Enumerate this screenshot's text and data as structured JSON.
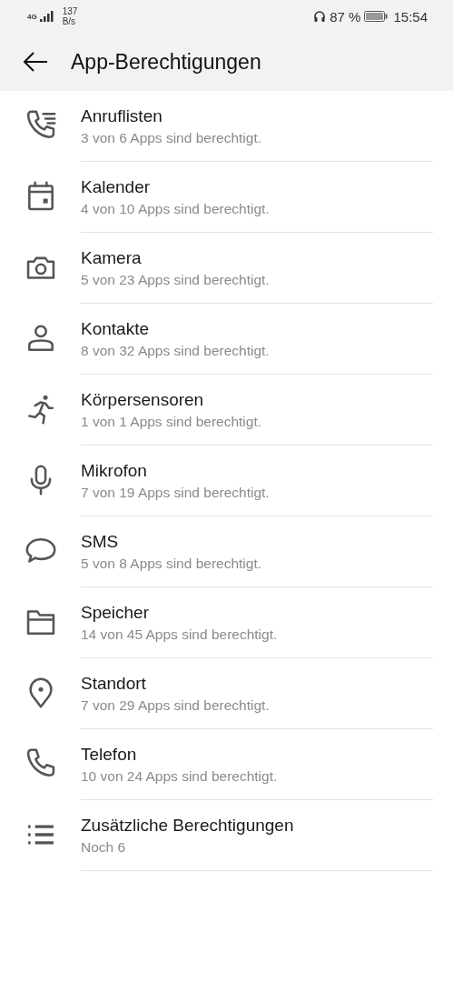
{
  "status_bar": {
    "network": "4G",
    "speed": "137",
    "speed_unit": "B/s",
    "battery": "87 %",
    "time": "15:54"
  },
  "header": {
    "title": "App-Berechtigungen"
  },
  "items": [
    {
      "kind": "call-log",
      "title": "Anruflisten",
      "subtitle": "3 von 6 Apps sind berechtigt."
    },
    {
      "kind": "calendar",
      "title": "Kalender",
      "subtitle": "4 von 10 Apps sind berechtigt."
    },
    {
      "kind": "camera",
      "title": "Kamera",
      "subtitle": "5 von 23 Apps sind berechtigt."
    },
    {
      "kind": "contact",
      "title": "Kontakte",
      "subtitle": "8 von 32 Apps sind berechtigt."
    },
    {
      "kind": "runner",
      "title": "Körpersensoren",
      "subtitle": "1 von 1 Apps sind berechtigt."
    },
    {
      "kind": "mic",
      "title": "Mikrofon",
      "subtitle": "7 von 19 Apps sind berechtigt."
    },
    {
      "kind": "sms",
      "title": "SMS",
      "subtitle": "5 von 8 Apps sind berechtigt."
    },
    {
      "kind": "folder",
      "title": "Speicher",
      "subtitle": "14 von 45 Apps sind berechtigt."
    },
    {
      "kind": "location",
      "title": "Standort",
      "subtitle": "7 von 29 Apps sind berechtigt."
    },
    {
      "kind": "phone",
      "title": "Telefon",
      "subtitle": "10 von 24 Apps sind berechtigt."
    },
    {
      "kind": "list",
      "title": "Zusätzliche Berechtigungen",
      "subtitle": "Noch 6"
    }
  ]
}
